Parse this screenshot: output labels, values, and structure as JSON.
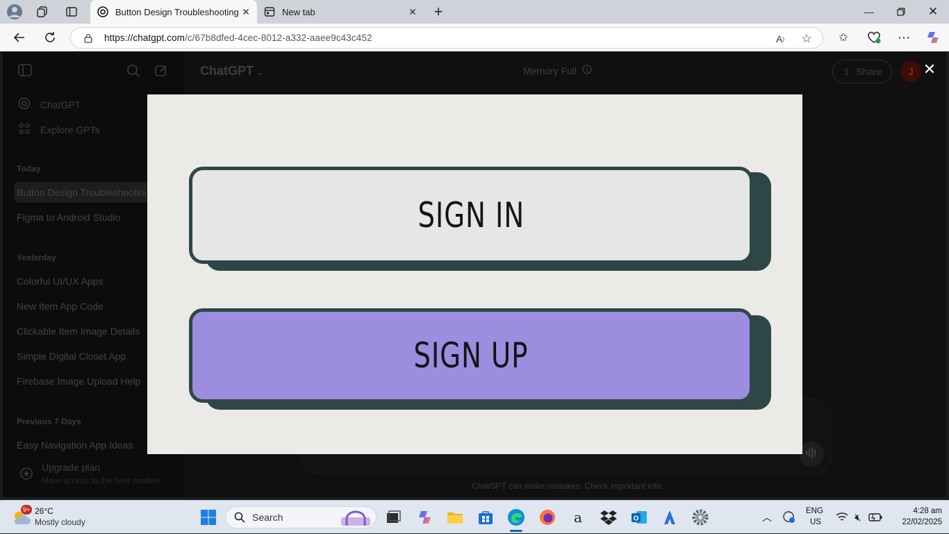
{
  "browser": {
    "tabs": [
      {
        "title": "Button Design Troubleshooting",
        "active": true
      },
      {
        "title": "New tab",
        "active": false
      }
    ],
    "url_domain": "https://chatgpt.com",
    "url_path": "/c/67b8dfed-4cec-8012-a332-aaee9c43c452"
  },
  "app": {
    "brand": "ChatGPT",
    "memory_status": "Memory Full",
    "share_label": "Share",
    "avatar_initial": "J",
    "disclaimer": "ChatGPT can make mistakes. Check important info."
  },
  "sidebar": {
    "top_items": [
      {
        "label": "ChatGPT"
      },
      {
        "label": "Explore GPTs"
      }
    ],
    "groups": [
      {
        "heading": "Today",
        "items": [
          "Button Design Troubleshooting",
          "Figma to Android Studio"
        ]
      },
      {
        "heading": "Yesterday",
        "items": [
          "Colorful UI/UX Apps",
          "New Item App Code",
          "Clickable Item Image Details",
          "Simple Digital Closet App",
          "Firebase Image Upload Help"
        ]
      },
      {
        "heading": "Previous 7 Days",
        "items": [
          "Easy Navigation App Ideas"
        ]
      }
    ],
    "upgrade_title": "Upgrade plan",
    "upgrade_subtitle": "More access to the best models"
  },
  "lightbox": {
    "buttons": [
      {
        "label": "SIGN IN",
        "color": "#e6e6e4"
      },
      {
        "label": "SIGN UP",
        "color": "#9d8ddf"
      }
    ],
    "border_color": "#2f4647",
    "background": "#ebeae6"
  },
  "taskbar": {
    "weather_temp": "26°C",
    "weather_desc": "Mostly cloudy",
    "weather_badge": "9+",
    "search_label": "Search",
    "lang_primary": "ENG",
    "lang_region": "US",
    "time": "4:28 am",
    "date": "22/02/2025"
  }
}
